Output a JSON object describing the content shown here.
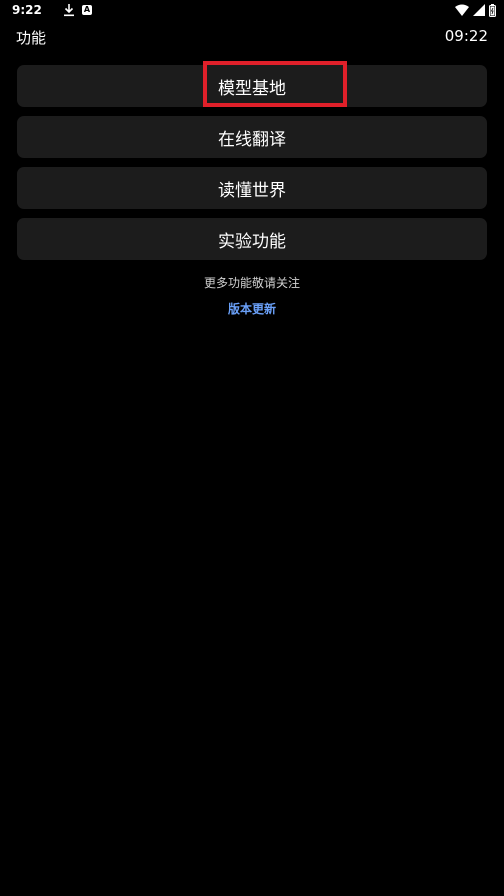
{
  "status_bar": {
    "time": "9:22",
    "notification_icons": [
      "download-icon",
      "a-app-icon"
    ],
    "system_icons": [
      "wifi-icon",
      "signal-icon",
      "battery-icon"
    ]
  },
  "header": {
    "title": "功能",
    "clock": "09:22"
  },
  "menu": {
    "items": [
      {
        "label": "模型基地",
        "highlighted": true
      },
      {
        "label": "在线翻译"
      },
      {
        "label": "读懂世界"
      },
      {
        "label": "实验功能"
      }
    ]
  },
  "footer": {
    "note": "更多功能敬请关注",
    "link": "版本更新"
  },
  "colors": {
    "background": "#000000",
    "menu_item_bg": "#1c1c1c",
    "highlight_border": "#e0202a",
    "link": "#6aa0f8"
  }
}
